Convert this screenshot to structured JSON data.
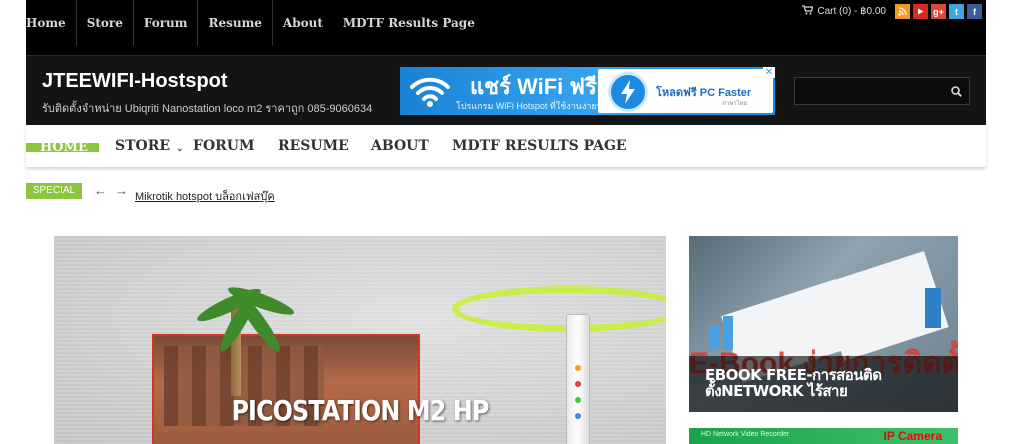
{
  "topbar": {
    "links": [
      "Home",
      "Store",
      "Forum",
      "Resume",
      "About",
      "MDTF Results Page"
    ],
    "cart_text": "Cart (0) - ฿0.00",
    "social_icons": [
      {
        "name": "rss-icon",
        "color": "#f39a1d",
        "glyph": "●"
      },
      {
        "name": "youtube-icon",
        "color": "#d42b22",
        "glyph": "▶"
      },
      {
        "name": "google-plus-icon",
        "color": "#d64b39",
        "glyph": "g+"
      },
      {
        "name": "twitter-icon",
        "color": "#3fa4e0",
        "glyph": "t"
      },
      {
        "name": "facebook-icon",
        "color": "#3b5b9a",
        "glyph": "f"
      }
    ]
  },
  "header": {
    "site_title": "JTEEWIFI-Hostspot",
    "tagline": "รับติดตั้งจำหน่าย Ubiqriti Nanostation loco m2 ราคาถูก 085-9060634",
    "ad": {
      "headline": "แชร์ WiFi ฟรี",
      "subline": "โปรแกรม WiFi Hotspot ที่ใช้งานง่ายที่สุด",
      "right_title": "โหลดฟรี PC Faster",
      "right_sub": "ภาษาไทย",
      "close_label": "✕"
    }
  },
  "mainnav": {
    "items": [
      "HOME",
      "STORE",
      "FORUM",
      "RESUME",
      "ABOUT",
      "MDTF RESULTS PAGE"
    ],
    "accent": "#8cc63f"
  },
  "ticker": {
    "label": "SPECIAL",
    "prev": "←",
    "next": "→",
    "link_text": "Mikrotik hotspot บล็อกเฟสบุ๊ค"
  },
  "hero": {
    "title": "PICOSTATION M2 HP"
  },
  "side": {
    "card1_big": "E-Book ง่ายการติดตั้ง",
    "card1_title": "EBOOK FREE-การสอนติดตั้งNETWORK ไร้สาย",
    "card2_left": "HD Network Video Recorder",
    "card2_right": "IP Camera"
  }
}
